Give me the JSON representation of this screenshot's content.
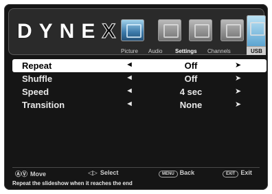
{
  "brand": {
    "name": "DYNEX"
  },
  "tabs": [
    {
      "label": "Picture",
      "active": false
    },
    {
      "label": "Audio",
      "active": false
    },
    {
      "label": "Settings",
      "active": true
    },
    {
      "label": "Channels",
      "active": false
    },
    {
      "label": "USB",
      "active": true
    }
  ],
  "menu": {
    "rows": [
      {
        "label": "Repeat",
        "value": "Off",
        "selected": true
      },
      {
        "label": "Shuffle",
        "value": "Off",
        "selected": false
      },
      {
        "label": "Speed",
        "value": "4 sec",
        "selected": false
      },
      {
        "label": "Transition",
        "value": "None",
        "selected": false
      }
    ],
    "left_arrow": "◄",
    "right_arrow": "➤"
  },
  "footer": {
    "move": {
      "icon": "ⒶⓋ",
      "label": "Move"
    },
    "select": {
      "icon": "◁▷",
      "label": "Select"
    },
    "back": {
      "key": "MENU",
      "label": "Back"
    },
    "exit": {
      "key": "EXIT",
      "label": "Exit"
    }
  },
  "description": "Repeat the slideshow when it reaches the end"
}
